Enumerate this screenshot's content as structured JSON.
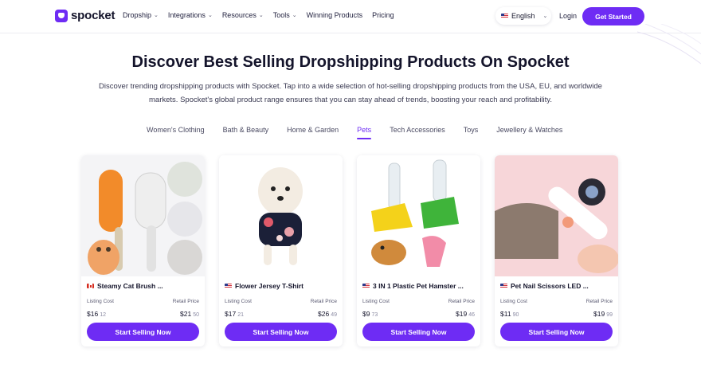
{
  "nav": {
    "logo_text": "spocket",
    "menu": [
      {
        "label": "Dropship",
        "has_dropdown": true
      },
      {
        "label": "Integrations",
        "has_dropdown": true
      },
      {
        "label": "Resources",
        "has_dropdown": true
      },
      {
        "label": "Tools",
        "has_dropdown": true
      },
      {
        "label": "Winning Products",
        "has_dropdown": false
      },
      {
        "label": "Pricing",
        "has_dropdown": false
      }
    ],
    "language": "English",
    "login": "Login",
    "cta": "Get Started"
  },
  "hero": {
    "title": "Discover Best Selling Dropshipping Products On Spocket",
    "description": "Discover trending dropshipping products with Spocket. Tap into a wide selection of hot-selling dropshipping products from the USA, EU, and worldwide markets. Spocket's global product range ensures that you can stay ahead of trends, boosting your reach and profitability."
  },
  "tabs": [
    {
      "label": "Women's Clothing",
      "active": false
    },
    {
      "label": "Bath & Beauty",
      "active": false
    },
    {
      "label": "Home & Garden",
      "active": false
    },
    {
      "label": "Pets",
      "active": true
    },
    {
      "label": "Tech Accessories",
      "active": false
    },
    {
      "label": "Toys",
      "active": false
    },
    {
      "label": "Jewellery & Watches",
      "active": false
    }
  ],
  "products": [
    {
      "title": "Steamy Cat Brush ...",
      "origin": "CA",
      "listing_label": "Listing Cost",
      "retail_label": "Retail Price",
      "listing_main": "$16",
      "listing_cents": "12",
      "retail_main": "$21",
      "retail_cents": "50",
      "button": "Start Selling Now",
      "image_bg": "#f4f4f6"
    },
    {
      "title": "Flower Jersey T-Shirt",
      "origin": "US",
      "listing_label": "Listing Cost",
      "retail_label": "Retail Price",
      "listing_main": "$17",
      "listing_cents": "21",
      "retail_main": "$26",
      "retail_cents": "49",
      "button": "Start Selling Now",
      "image_bg": "#ffffff"
    },
    {
      "title": "3 IN 1 Plastic Pet Hamster ...",
      "origin": "US",
      "listing_label": "Listing Cost",
      "retail_label": "Retail Price",
      "listing_main": "$9",
      "listing_cents": "73",
      "retail_main": "$19",
      "retail_cents": "46",
      "button": "Start Selling Now",
      "image_bg": "#ffffff"
    },
    {
      "title": "Pet Nail Scissors LED ...",
      "origin": "US",
      "listing_label": "Listing Cost",
      "retail_label": "Retail Price",
      "listing_main": "$11",
      "listing_cents": "90",
      "retail_main": "$19",
      "retail_cents": "99",
      "button": "Start Selling Now",
      "image_bg": "#f7d6d9"
    }
  ],
  "colors": {
    "brand": "#6e2cf4",
    "text": "#14142b",
    "muted": "#5a5a72"
  },
  "icons": {
    "logo": "spocket-bag-icon",
    "chevron": "chevron-down-icon"
  }
}
